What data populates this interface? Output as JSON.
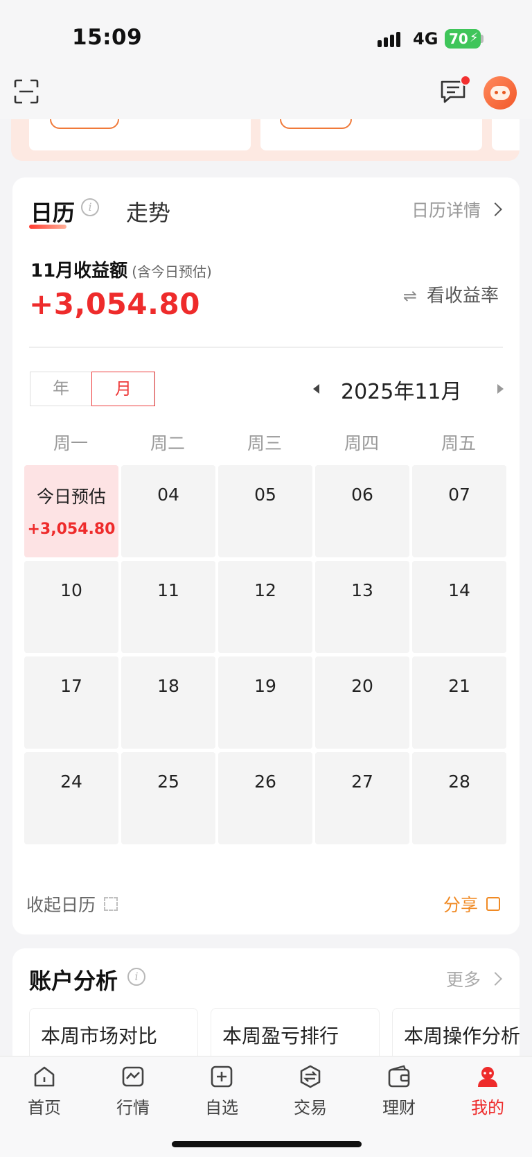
{
  "status_bar": {
    "time": "15:09",
    "network": "4G",
    "battery": "70"
  },
  "calendar": {
    "tabs": {
      "active": "日历",
      "other": "走势"
    },
    "detail_link": "日历详情",
    "earnings_label": "11月收益额",
    "earnings_note": "(含今日预估)",
    "earnings_value": "+3,054.80",
    "rate_toggle": "看收益率",
    "segment": {
      "year": "年",
      "month": "月"
    },
    "month_label": "2025年11月",
    "weekdays": [
      "周一",
      "周二",
      "周三",
      "周四",
      "周五"
    ],
    "today": {
      "label": "今日预估",
      "value": "+3,054.80"
    },
    "days": [
      "04",
      "05",
      "06",
      "07",
      "10",
      "11",
      "12",
      "13",
      "14",
      "17",
      "18",
      "19",
      "20",
      "21",
      "24",
      "25",
      "26",
      "27",
      "28"
    ],
    "collapse_label": "收起日历",
    "share_label": "分享"
  },
  "account": {
    "title": "账户分析",
    "more": "更多",
    "cards": [
      "本周市场对比",
      "本周盈亏排行",
      "本周操作分析"
    ]
  },
  "tabbar": {
    "items": [
      {
        "label": "首页",
        "icon": "home-icon"
      },
      {
        "label": "行情",
        "icon": "chart-icon"
      },
      {
        "label": "自选",
        "icon": "add-square-icon"
      },
      {
        "label": "交易",
        "icon": "trade-icon"
      },
      {
        "label": "理财",
        "icon": "wallet-icon"
      },
      {
        "label": "我的",
        "icon": "profile-icon"
      }
    ],
    "active_color": "#ee2b2b"
  },
  "colors": {
    "accent_red": "#ee2b2b",
    "share_orange": "#f08a24"
  }
}
